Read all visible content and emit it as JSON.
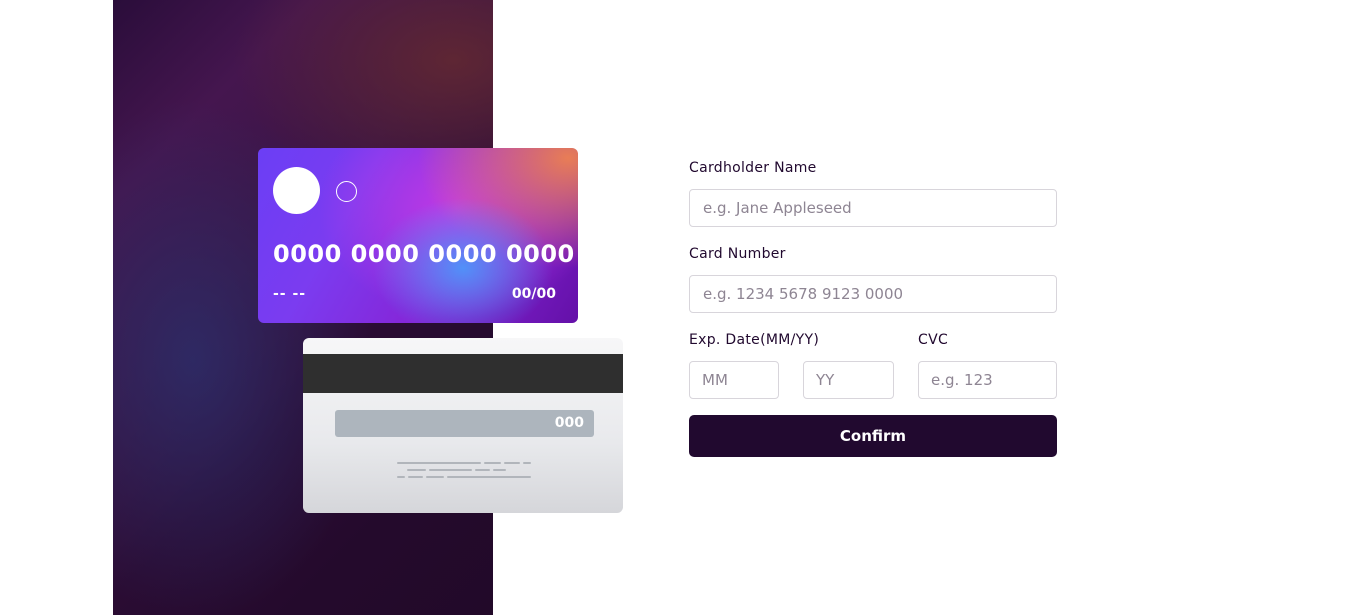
{
  "card_front": {
    "number": "0000 0000 0000 0000",
    "name": "-- --",
    "expiry": "00/00"
  },
  "card_back": {
    "cvc": "000"
  },
  "form": {
    "cardholder_label": "Cardholder Name",
    "cardholder_placeholder": "e.g. Jane Appleseed",
    "number_label": "Card Number",
    "number_placeholder": "e.g. 1234 5678 9123 0000",
    "expiry_label": "Exp. Date(MM/YY)",
    "month_placeholder": "MM",
    "year_placeholder": "YY",
    "cvc_label": "CVC",
    "cvc_placeholder": "e.g. 123",
    "confirm_label": "Confirm"
  },
  "colors": {
    "primary_dark": "#21092f",
    "input_border": "#d8d5db",
    "placeholder": "#8e8593"
  }
}
